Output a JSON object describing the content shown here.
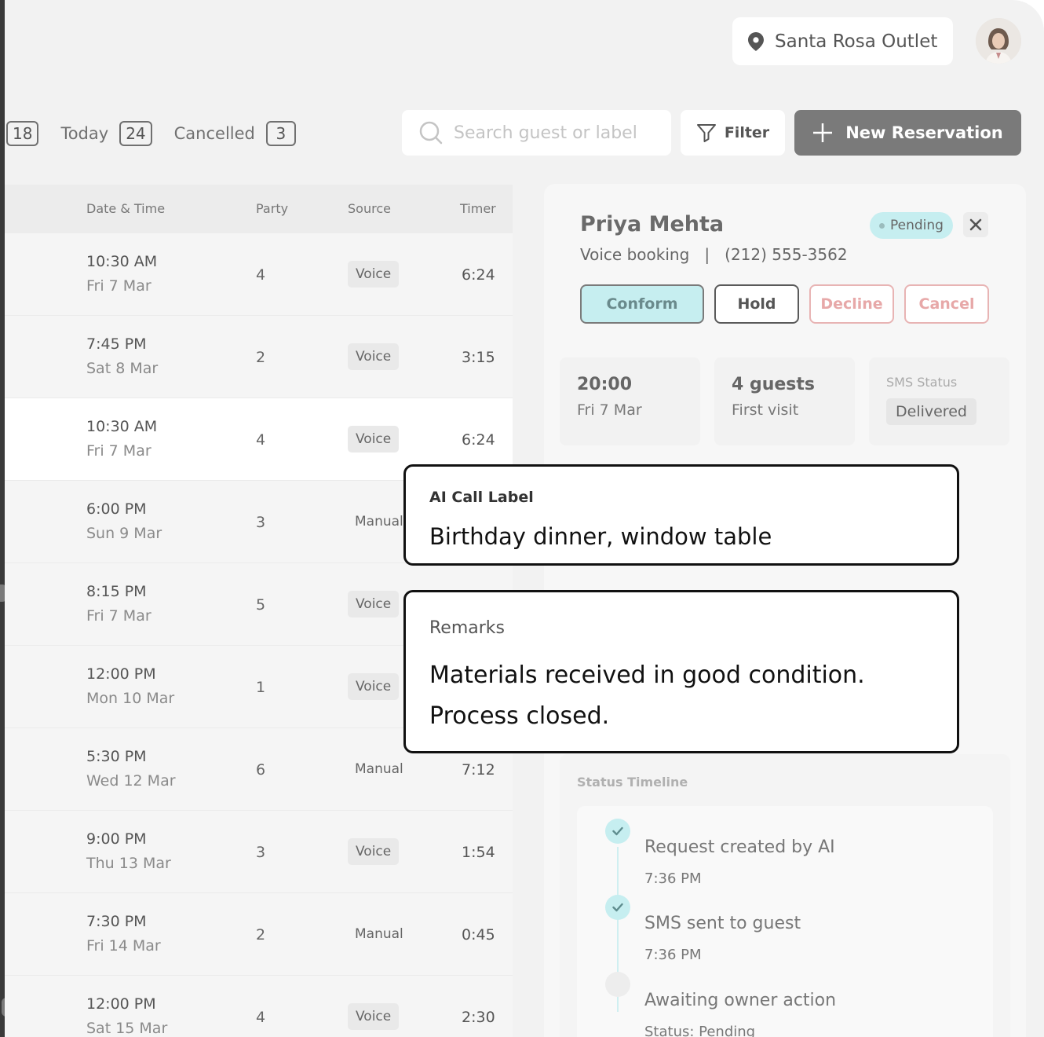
{
  "header": {
    "location": "Santa Rosa Outlet",
    "location_icon": "map-pin-icon",
    "avatar_icon": "user-avatar"
  },
  "counters": [
    {
      "label": "",
      "count": "18"
    },
    {
      "label": "Today",
      "count": "24"
    },
    {
      "label": "Cancelled",
      "count": "3"
    }
  ],
  "search": {
    "placeholder": "Search guest or label"
  },
  "toolbar": {
    "filter_label": "Filter",
    "new_label": "New Reservation"
  },
  "table": {
    "columns": {
      "datetime": "Date & Time",
      "party": "Party",
      "source": "Source",
      "timer": "Timer"
    },
    "rows": [
      {
        "time": "10:30 AM",
        "date": "Fri 7 Mar",
        "party": "4",
        "source": "Voice",
        "timer": "6:24"
      },
      {
        "time": "7:45 PM",
        "date": "Sat 8 Mar",
        "party": "2",
        "source": "Voice",
        "timer": "3:15"
      },
      {
        "time": "10:30 AM",
        "date": "Fri 7 Mar",
        "party": "4",
        "source": "Voice",
        "timer": "6:24"
      },
      {
        "time": "6:00 PM",
        "date": "Sun 9 Mar",
        "party": "3",
        "source": "Manual",
        "timer": ""
      },
      {
        "time": "8:15 PM",
        "date": "Fri 7 Mar",
        "party": "5",
        "source": "Voice",
        "timer": ""
      },
      {
        "time": "12:00 PM",
        "date": "Mon 10 Mar",
        "party": "1",
        "source": "Voice",
        "timer": ""
      },
      {
        "time": "5:30 PM",
        "date": "Wed 12 Mar",
        "party": "6",
        "source": "Manual",
        "timer": "7:12"
      },
      {
        "time": "9:00 PM",
        "date": "Thu 13 Mar",
        "party": "3",
        "source": "Voice",
        "timer": "1:54"
      },
      {
        "time": "7:30 PM",
        "date": "Fri 14 Mar",
        "party": "2",
        "source": "Manual",
        "timer": "0:45"
      },
      {
        "time": "12:00 PM",
        "date": "Sat 15 Mar",
        "party": "4",
        "source": "Voice",
        "timer": "2:30"
      }
    ]
  },
  "detail": {
    "name": "Priya Mehta",
    "subtitle": "Voice booking   |   (212) 555-3562",
    "status": "Pending",
    "actions": {
      "conform": "Conform",
      "hold": "Hold",
      "decline": "Decline",
      "cancel": "Cancel"
    },
    "time_card": {
      "value": "20:00",
      "sub": "Fri 7 Mar"
    },
    "guests_card": {
      "value": "4 guests",
      "sub": "First visit"
    },
    "sms_card": {
      "caption": "SMS Status",
      "value": "Delivered"
    },
    "timeline": {
      "title": "Status Timeline",
      "items": [
        {
          "title": "Request created by AI",
          "sub": "7:36 PM"
        },
        {
          "title": "SMS sent to guest",
          "sub": "7:36 PM"
        },
        {
          "title": "Awaiting owner action",
          "sub": "Status: Pending"
        }
      ]
    }
  },
  "callouts": {
    "ai_label_title": "AI Call Label",
    "ai_label_text": "Birthday dinner, window table",
    "remarks_title": "Remarks",
    "remarks_text": "Materials received in good condition. Process closed."
  },
  "colors": {
    "accent": "#c6eef0",
    "danger": "#e8b4b4",
    "primary_button": "#7a7a7a"
  }
}
